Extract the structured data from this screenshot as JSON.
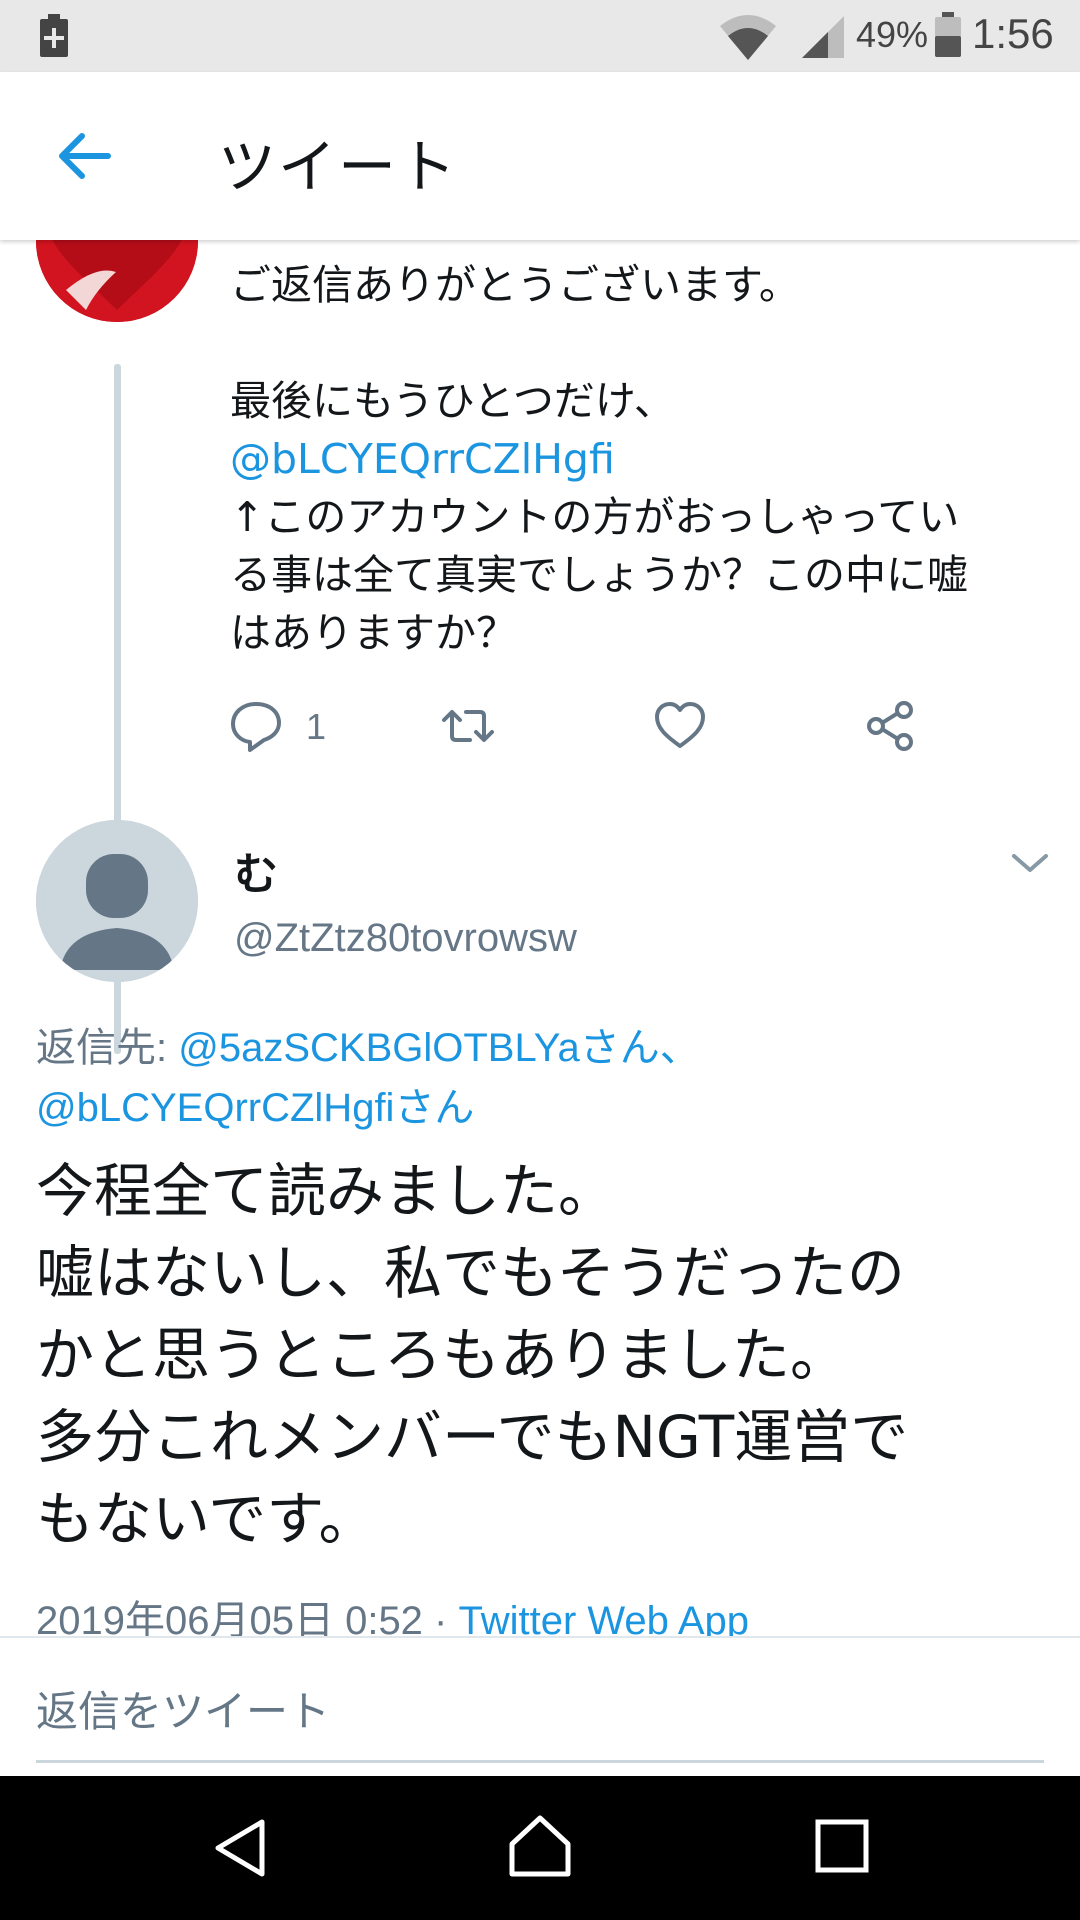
{
  "status_bar": {
    "battery_percent": "49%",
    "time": "1:56",
    "icons": [
      "battery-saver-icon",
      "wifi-icon",
      "signal-icon",
      "battery-icon"
    ]
  },
  "header": {
    "title": "ツイート",
    "back_icon": "back-arrow-icon",
    "accent_color": "#1b95e0"
  },
  "previous_tweet": {
    "avatar": "heart-avatar",
    "text_lines": [
      "ご返信ありがとうございます。",
      "",
      "最後にもうひとつだけ、"
    ],
    "mention": "@bLCYEQrrCZlHgfi",
    "text_after_lines": [
      "↑このアカウントの方がおっしゃってい",
      "る事は全て真実でしょうか？この中に嘘",
      "はありますか？"
    ],
    "actions": {
      "reply_count": "1",
      "icons": [
        "reply-icon",
        "retweet-icon",
        "like-icon",
        "share-icon"
      ]
    }
  },
  "main_tweet": {
    "display_name": "む",
    "handle": "@ZtZtz80tovrowsw",
    "reply_to_label": "返信先: ",
    "reply_to_user1": "@5azSCKBGlOTBLYaさん、",
    "reply_to_user2": "@bLCYEQrrCZlHgfiさん",
    "body_lines": [
      "今程全て読みました。",
      "嘘はないし、私でもそうだったの",
      "かと思うところもありました。",
      "多分これメンバーでもNGT運営で",
      "もないです。"
    ],
    "timestamp": "2019年06月05日 0:52 · ",
    "source": "Twitter Web App"
  },
  "composer": {
    "placeholder": "返信をツイート"
  },
  "nav_bar": {
    "icons": [
      "nav-back-icon",
      "nav-home-icon",
      "nav-recents-icon"
    ]
  }
}
